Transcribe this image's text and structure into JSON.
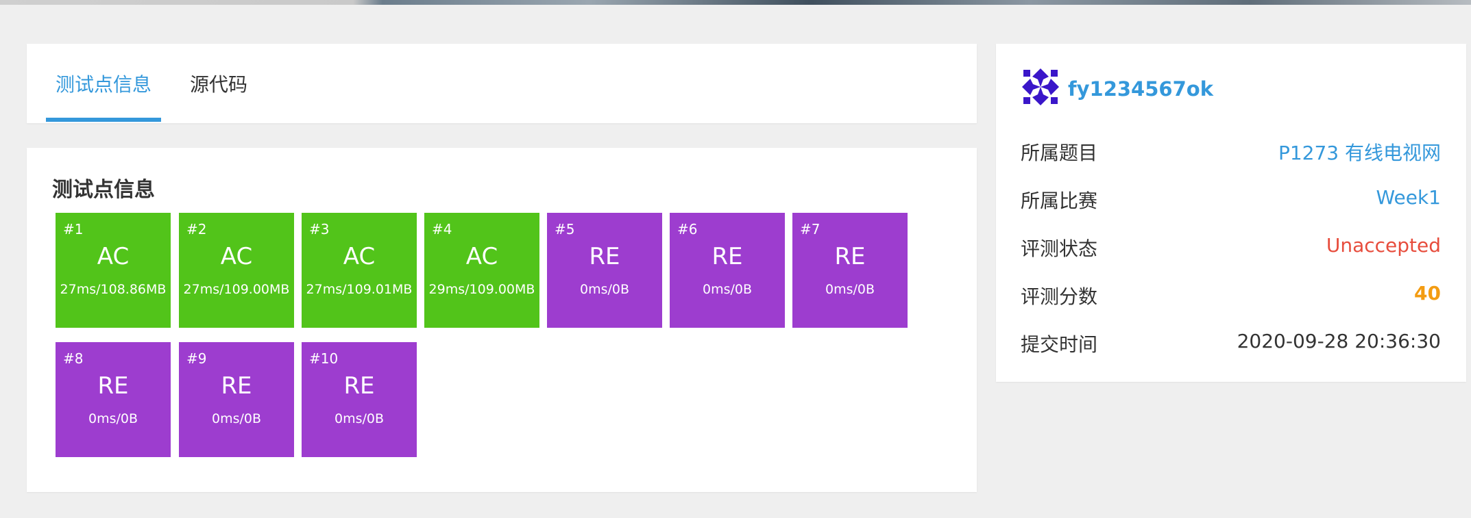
{
  "tabs": [
    {
      "label": "测试点信息",
      "active": true
    },
    {
      "label": "源代码",
      "active": false
    }
  ],
  "testcases": {
    "title": "测试点信息",
    "cases": [
      {
        "num": "#1",
        "status": "AC",
        "usage": "27ms/108.86MB"
      },
      {
        "num": "#2",
        "status": "AC",
        "usage": "27ms/109.00MB"
      },
      {
        "num": "#3",
        "status": "AC",
        "usage": "27ms/109.01MB"
      },
      {
        "num": "#4",
        "status": "AC",
        "usage": "29ms/109.00MB"
      },
      {
        "num": "#5",
        "status": "RE",
        "usage": "0ms/0B"
      },
      {
        "num": "#6",
        "status": "RE",
        "usage": "0ms/0B"
      },
      {
        "num": "#7",
        "status": "RE",
        "usage": "0ms/0B"
      },
      {
        "num": "#8",
        "status": "RE",
        "usage": "0ms/0B"
      },
      {
        "num": "#9",
        "status": "RE",
        "usage": "0ms/0B"
      },
      {
        "num": "#10",
        "status": "RE",
        "usage": "0ms/0B"
      }
    ],
    "colors": {
      "AC": "#52c41a",
      "RE": "#9d3dcf"
    }
  },
  "info": {
    "username": "fy1234567ok",
    "avatar_icon": "pinwheel-avatar-icon",
    "rows": [
      {
        "label": "所属题目",
        "value": "P1273 有线电视网"
      },
      {
        "label": "所属比赛",
        "value": "Week1"
      },
      {
        "label": "评测状态",
        "value": "Unaccepted"
      },
      {
        "label": "评测分数",
        "value": "40"
      },
      {
        "label": "提交时间",
        "value": "2020-09-28 20:36:30"
      }
    ],
    "colors": {
      "link": "#3498db",
      "unaccepted": "#e74c3c",
      "score": "#f39c12"
    }
  }
}
